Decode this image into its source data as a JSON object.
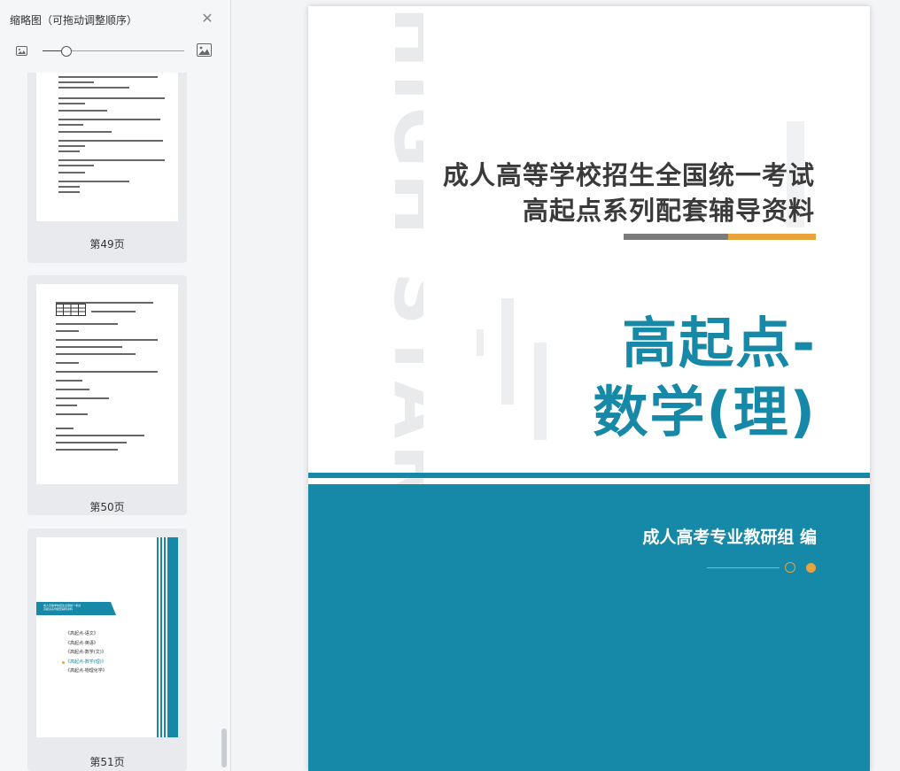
{
  "sidebar": {
    "title": "缩略图（可拖动调整顺序）",
    "close_icon": "close-icon",
    "zoom": {
      "level": 0.17,
      "zoom_out_icon": "image-small-icon",
      "zoom_in_icon": "image-large-icon"
    },
    "thumbnails": [
      {
        "label": "第49页"
      },
      {
        "label": "第50页"
      },
      {
        "label": "第51页",
        "toc_header": [
          "成人高等学校招生全国统一考试",
          "高起点系列配套辅导资料"
        ],
        "toc": [
          "《高起点-语文》",
          "《高起点-英语》",
          "《高起点-数学(文)》",
          "《高起点-数学(理)》",
          "《高起点-物理化学》"
        ],
        "toc_highlight_index": 3
      }
    ]
  },
  "page": {
    "watermark": "HIGH STARTING",
    "heading_line1": "成人高等学校招生全国统一考试",
    "heading_line2": "高起点系列配套辅导资料",
    "title_line1": "高起点-",
    "title_line2": "数学(理)",
    "editor": "成人高考专业教研组 编",
    "colors": {
      "teal": "#1789a8",
      "orange": "#e8a33d",
      "grey": "#7c7c7c"
    }
  }
}
